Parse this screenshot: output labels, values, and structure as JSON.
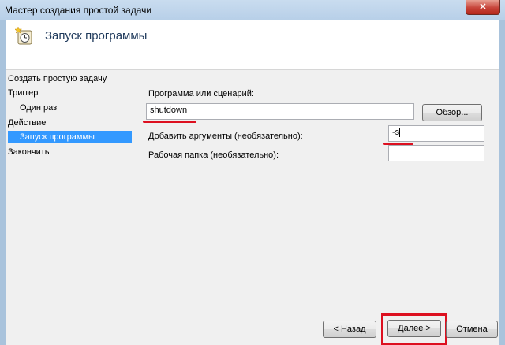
{
  "window": {
    "title": "Мастер создания простой задачи",
    "close_label": "✕"
  },
  "header": {
    "title": "Запуск программы",
    "icon": "clock-task-icon"
  },
  "nav": {
    "items": [
      {
        "label": "Создать простую задачу",
        "selected": false
      },
      {
        "label": "Триггер",
        "selected": false
      },
      {
        "label": "Один раз",
        "selected": false
      },
      {
        "label": "Действие",
        "selected": false
      },
      {
        "label": "Запуск программы",
        "selected": true
      },
      {
        "label": "Закончить",
        "selected": false
      }
    ]
  },
  "form": {
    "program_label": "Программа или сценарий:",
    "program_value": "shutdown",
    "browse_label": "Обзор...",
    "args_label": "Добавить аргументы (необязательно):",
    "args_value": "-s",
    "workdir_label": "Рабочая папка (необязательно):",
    "workdir_value": ""
  },
  "buttons": {
    "back_label": "< Назад",
    "next_label": "Далее >",
    "cancel_label": "Отмена"
  },
  "colors": {
    "highlight_red": "#dd1020",
    "selection_blue": "#3399ff"
  }
}
